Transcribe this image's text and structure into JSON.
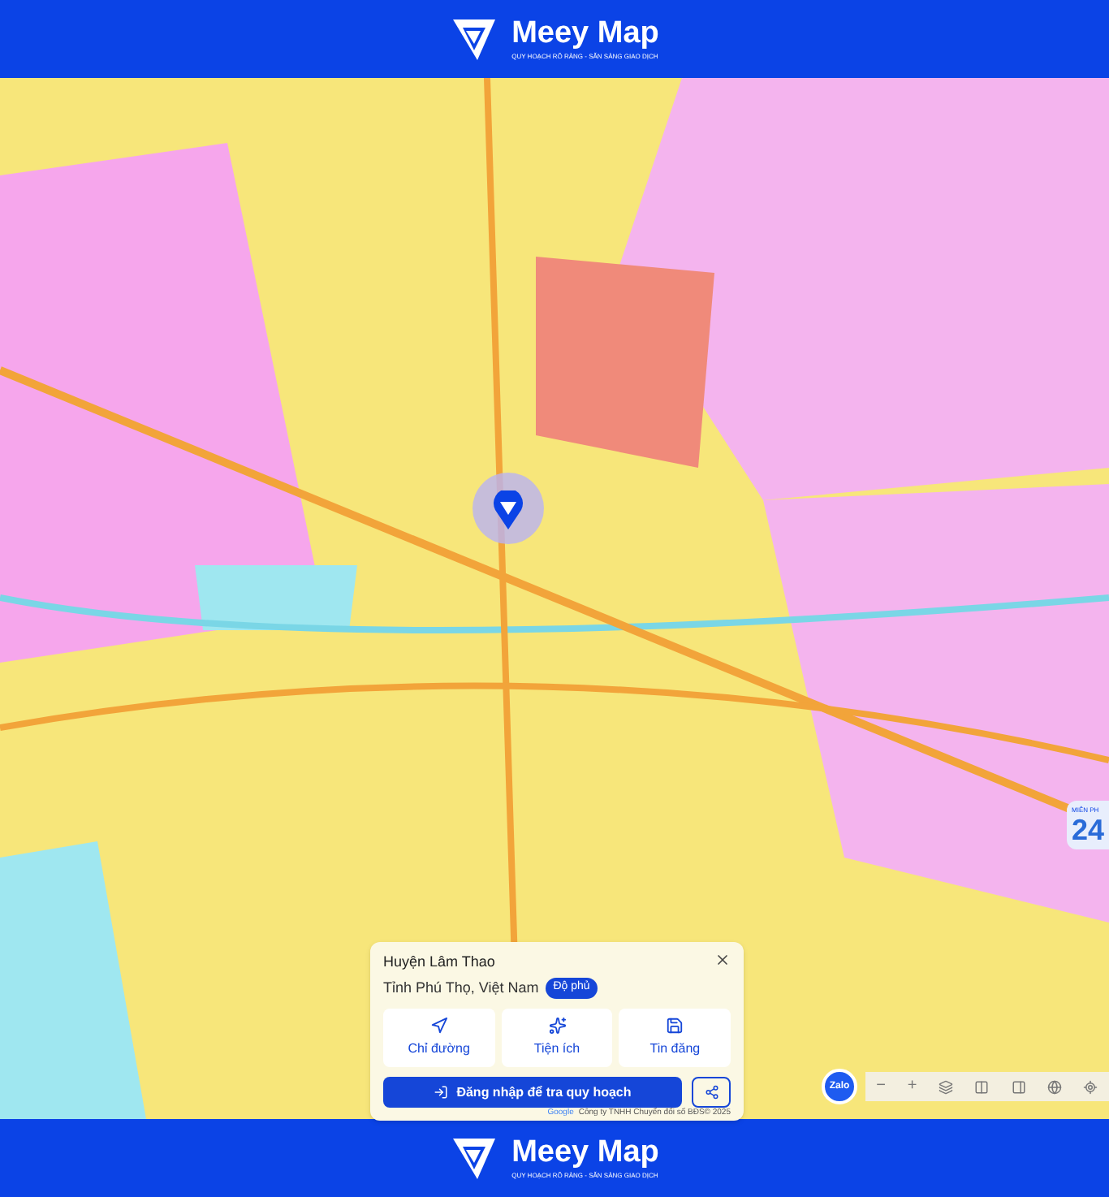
{
  "header": {
    "brand": "Meey Map",
    "tagline": "QUY HOẠCH RÕ RÀNG - SẴN SÀNG GIAO DỊCH"
  },
  "promo": {
    "label": "MIỄN PH",
    "number": "24"
  },
  "place_card": {
    "title": "Huyện Lâm Thao",
    "subtitle": "Tỉnh Phú Thọ, Việt Nam",
    "badge": "Độ phủ",
    "actions": [
      {
        "kind": "directions",
        "label": "Chỉ đường"
      },
      {
        "kind": "amenities",
        "label": "Tiện ích"
      },
      {
        "kind": "listings",
        "label": "Tin đăng"
      }
    ],
    "login_button": "Đăng nhập để tra quy hoạch"
  },
  "attribution": {
    "provider": "Google",
    "copyright": "Công ty TNHH Chuyển đổi số BĐS© 2025"
  },
  "chat_bubble": "Zalo",
  "map_controls": {
    "zoom_out": "−",
    "zoom_in": "+"
  },
  "footer": {
    "brand": "Meey Map",
    "tagline": "QUY HOẠCH RÕ RÀNG - SẴN SÀNG GIAO DỊCH"
  }
}
